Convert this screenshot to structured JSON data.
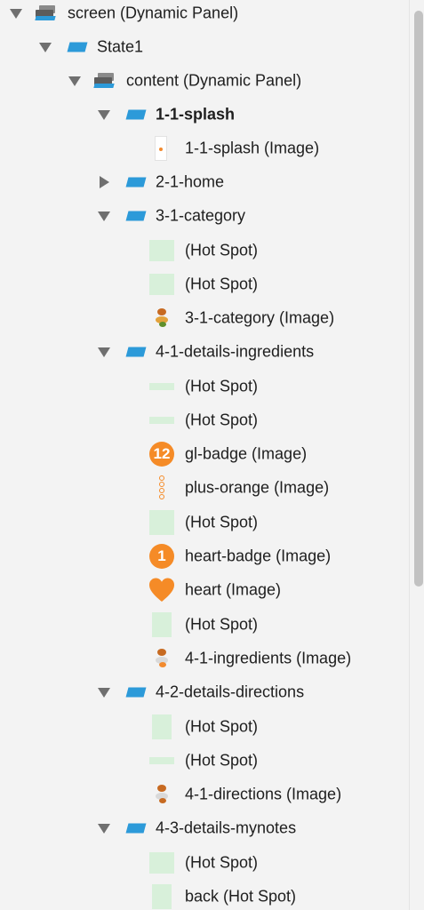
{
  "tree": {
    "screen": "screen (Dynamic Panel)",
    "state1": "State1",
    "content": "content (Dynamic Panel)",
    "splash": "1-1-splash",
    "splash_image": "1-1-splash (Image)",
    "home": "2-1-home",
    "category": "3-1-category",
    "cat_hot1": "(Hot Spot)",
    "cat_hot2": "(Hot Spot)",
    "cat_image": "3-1-category (Image)",
    "details_ingredients": "4-1-details-ingredients",
    "ing_hot1": "(Hot Spot)",
    "ing_hot2": "(Hot Spot)",
    "gl_badge": "gl-badge (Image)",
    "gl_badge_count": "12",
    "plus_orange": "plus-orange (Image)",
    "ing_hot3": "(Hot Spot)",
    "heart_badge": "heart-badge (Image)",
    "heart_badge_count": "1",
    "heart": "heart (Image)",
    "ing_hot4": "(Hot Spot)",
    "ingredients_image": "4-1-ingredients (Image)",
    "details_directions": "4-2-details-directions",
    "dir_hot1": "(Hot Spot)",
    "dir_hot2": "(Hot Spot)",
    "directions_image": "4-1-directions (Image)",
    "details_mynotes": "4-3-details-mynotes",
    "notes_hot1": "(Hot Spot)",
    "back_hot": "back (Hot Spot)"
  },
  "colors": {
    "state_blue": "#2c9ad9",
    "hotspot_green": "#d8f0da",
    "accent_orange": "#f58b27"
  }
}
